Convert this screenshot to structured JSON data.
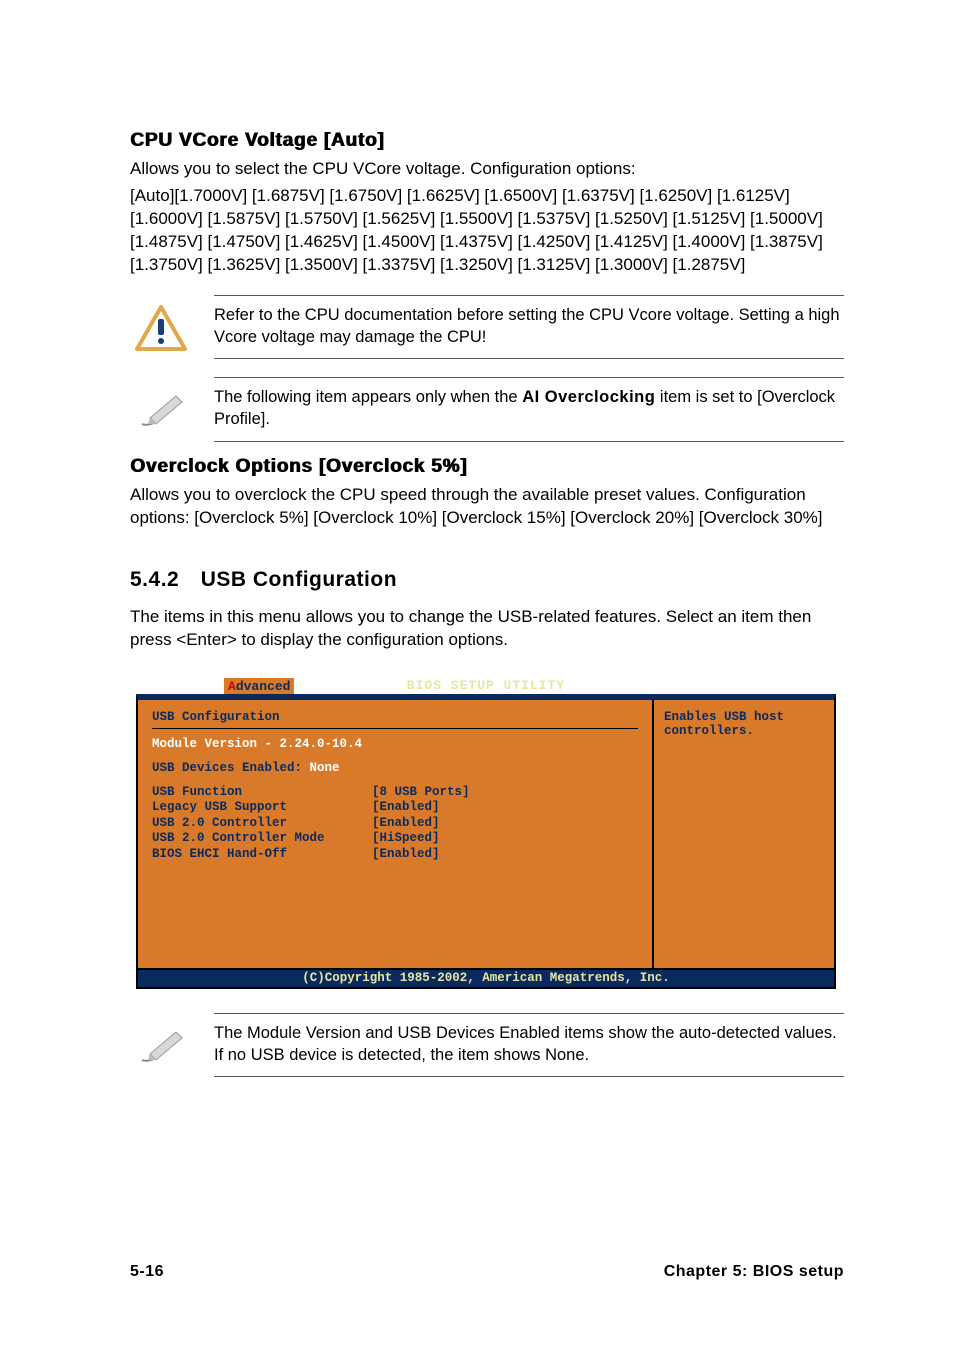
{
  "h1": "CPU VCore Voltage [Auto]",
  "p_vcore_intro": "Allows you to select the CPU VCore voltage. Configuration options:",
  "vcore_options": "[Auto][1.7000V] [1.6875V] [1.6750V] [1.6625V] [1.6500V] [1.6375V] [1.6250V] [1.6125V] [1.6000V] [1.5875V] [1.5750V] [1.5625V] [1.5500V] [1.5375V] [1.5250V] [1.5125V] [1.5000V] [1.4875V] [1.4750V] [1.4625V] [1.4500V] [1.4375V] [1.4250V] [1.4125V] [1.4000V] [1.3875V] [1.3750V] [1.3625V] [1.3500V] [1.3375V] [1.3250V] [1.3125V] [1.3000V] [1.2875V]",
  "note1": "Refer to the CPU documentation before setting the CPU Vcore voltage. Setting a high Vcore voltage may damage the CPU!",
  "note2_pre": "The following item appears only when the ",
  "note2_bold": "AI Overclocking",
  "note2_post": " item is set to [Overclock Profile].",
  "h2": "Overclock Options [Overclock 5%]",
  "p_overclock": "Allows you to overclock the CPU speed through the available preset values. Configuration options: [Overclock 5%] [Overclock 10%] [Overclock 15%] [Overclock 20%] [Overclock 30%]",
  "sec_num_title": "5.4.2 USB Configuration",
  "p_usb": "The items in this menu allows you to change the USB-related features. Select an item then press <Enter> to display the configuration options.",
  "bios": {
    "title": "BIOS SETUP UTILITY",
    "tab_letter": "A",
    "tab_rest": "dvanced",
    "panel_title": "USB Configuration",
    "module_label": "Module Version - ",
    "module_value": "2.24.0-10.4",
    "devices_label": "USB Devices Enabled: ",
    "devices_value": "None",
    "rows": [
      {
        "label": "USB Function",
        "value": "[8 USB Ports]"
      },
      {
        "label": "Legacy USB Support",
        "value": "[Enabled]"
      },
      {
        "label": "USB 2.0 Controller",
        "value": "[Enabled]"
      },
      {
        "label": "USB 2.0 Controller Mode",
        "value": "[HiSpeed]"
      },
      {
        "label": "BIOS EHCI Hand-Off",
        "value": "[Enabled]"
      }
    ],
    "help": "Enables USB host controllers.",
    "footer": "(C)Copyright 1985-2002, American Megatrends, Inc."
  },
  "note3": "The Module Version and USB Devices Enabled items show the auto-detected values. If no USB device is detected, the item shows None.",
  "footer_left": "5-16",
  "footer_right": "Chapter 5: BIOS setup"
}
